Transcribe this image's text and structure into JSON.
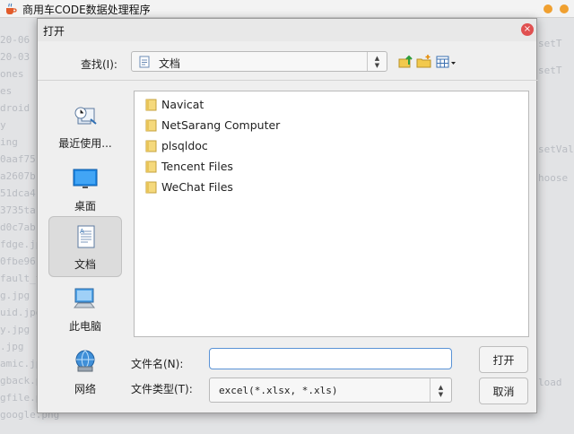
{
  "app": {
    "title": "商用车CODE数据处理程序",
    "background_code_lines": [
      "20-06",
      "20-03",
      "ones",
      "es",
      "droid",
      "y",
      "ing",
      "0aaf75",
      "a2607b",
      "51dca4",
      "3735ta",
      "d0c7ab",
      "fdge.jpg",
      "0fbe96",
      "fault_t",
      "g.jpg",
      "uid.jpg",
      "y.jpg",
      ".jpg",
      "amic.jp",
      "gback.p",
      "gfile.p",
      "google.png"
    ],
    "background_code_right": [
      "setT",
      "setT",
      "setVal",
      "hoose",
      "load"
    ]
  },
  "dialog": {
    "title": "打开",
    "close_label": "×",
    "look_in_label": "查找(I):",
    "look_in_value": "文档",
    "sidebar": [
      {
        "label": "最近使用...",
        "icon": "recent-icon",
        "selected": false
      },
      {
        "label": "桌面",
        "icon": "desktop-icon",
        "selected": false
      },
      {
        "label": "文档",
        "icon": "documents-icon",
        "selected": true
      },
      {
        "label": "此电脑",
        "icon": "computer-icon",
        "selected": false
      },
      {
        "label": "网络",
        "icon": "network-icon",
        "selected": false
      }
    ],
    "files": [
      {
        "name": "Navicat"
      },
      {
        "name": "NetSarang Computer"
      },
      {
        "name": "plsqldoc"
      },
      {
        "name": "Tencent Files"
      },
      {
        "name": "WeChat Files"
      }
    ],
    "file_name_label": "文件名(N):",
    "file_name_value": "",
    "file_type_label": "文件类型(T):",
    "file_type_value": "excel(*.xlsx, *.xls)",
    "open_button": "打开",
    "cancel_button": "取消",
    "colors": {
      "folder": "#f5d97c",
      "accent": "#5a93d6",
      "close": "#e05050"
    }
  }
}
